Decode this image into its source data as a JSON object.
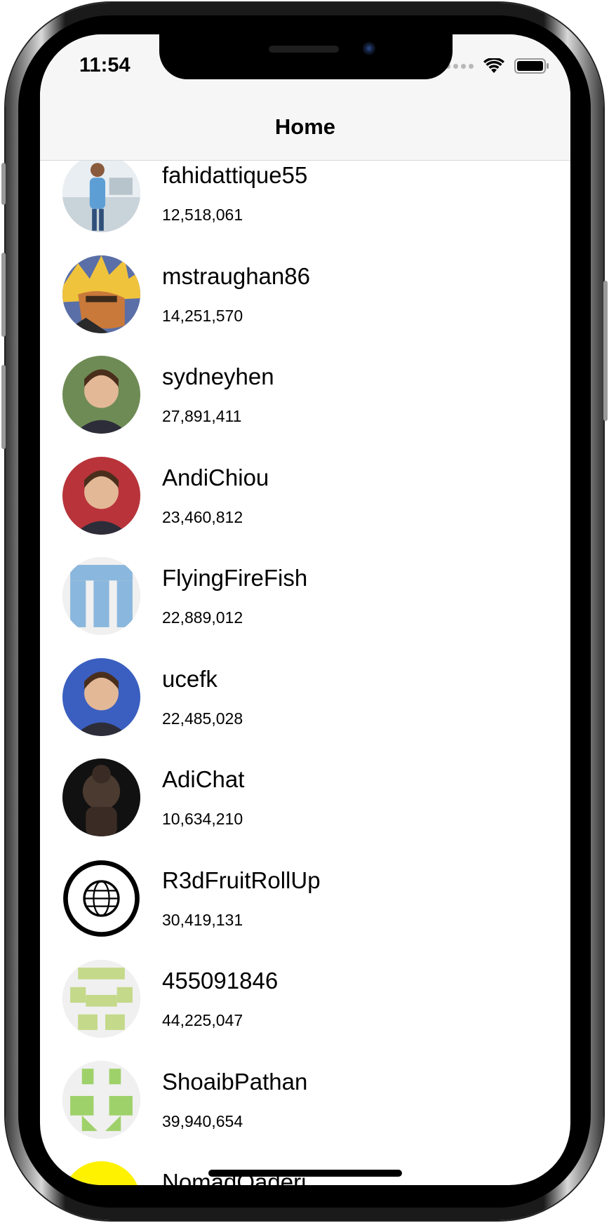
{
  "status_bar": {
    "time": "11:54",
    "wifi_icon": "wifi-icon",
    "battery_icon": "battery-icon"
  },
  "nav": {
    "title": "Home"
  },
  "users": [
    {
      "name": "fahidattique55",
      "count": "12,518,061",
      "avatar": "person-office-photo",
      "color": "#8fb4d8"
    },
    {
      "name": "mstraughan86",
      "count": "14,251,570",
      "avatar": "cartoon-character",
      "color": "#d9a431"
    },
    {
      "name": "sydneyhen",
      "count": "27,891,411",
      "avatar": "person-photo",
      "color": "#6f8b55"
    },
    {
      "name": "AndiChiou",
      "count": "23,460,812",
      "avatar": "person-photo",
      "color": "#b8343a"
    },
    {
      "name": "FlyingFireFish",
      "count": "22,889,012",
      "avatar": "identicon-blue",
      "color": "#8ab7dd"
    },
    {
      "name": "ucefk",
      "count": "22,485,028",
      "avatar": "person-photo",
      "color": "#3a5fc0"
    },
    {
      "name": "AdiChat",
      "count": "10,634,210",
      "avatar": "buddha-statue",
      "color": "#4a3a30"
    },
    {
      "name": "R3dFruitRollUp",
      "count": "30,419,131",
      "avatar": "asap-worldwide-logo",
      "color": "#000000"
    },
    {
      "name": "455091846",
      "count": "44,225,047",
      "avatar": "identicon-yellow-green",
      "color": "#c4d98a"
    },
    {
      "name": "ShoaibPathan",
      "count": "39,940,654",
      "avatar": "identicon-green",
      "color": "#9fd16a"
    },
    {
      "name": "NomadQaderi",
      "count": "",
      "avatar": "snapchat-bitmoji",
      "color": "#fff200"
    }
  ]
}
